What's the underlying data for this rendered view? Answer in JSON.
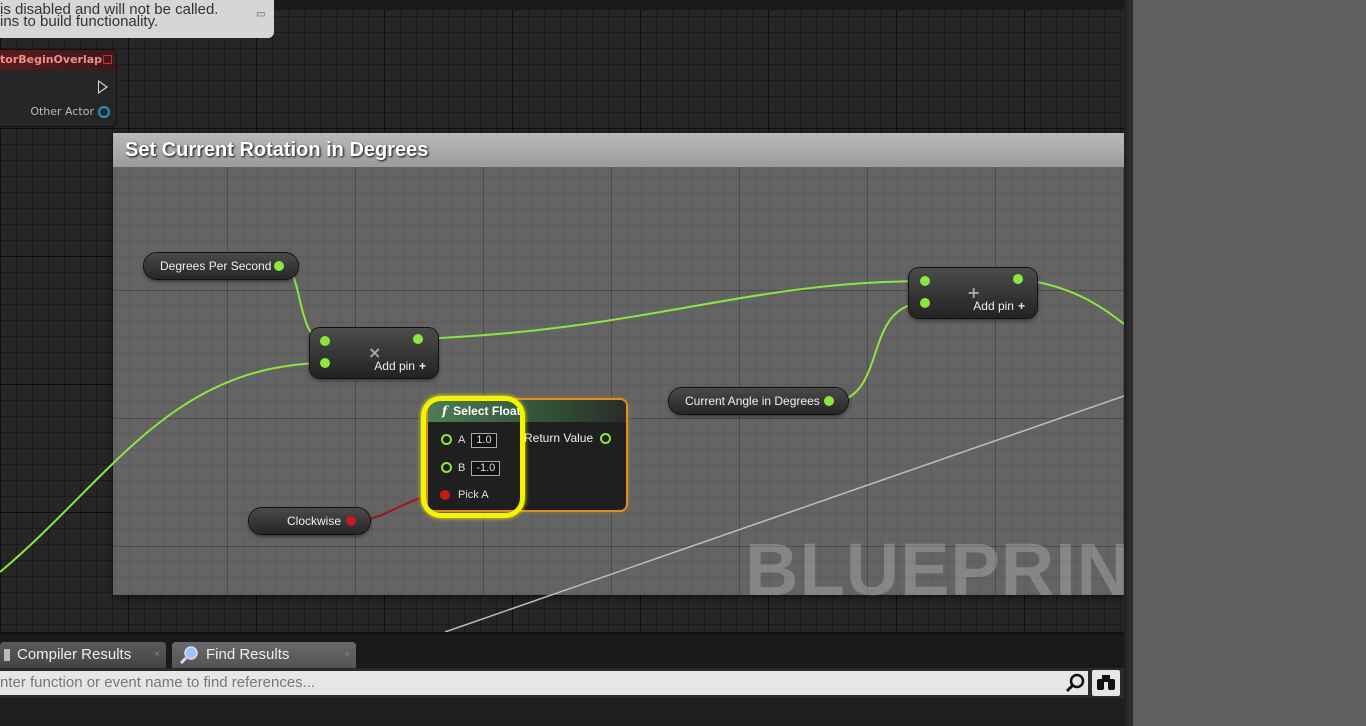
{
  "warning": {
    "line1": "is disabled and will not be called.",
    "line2": "ins to build functionality."
  },
  "event_node": {
    "title": "torBeginOverlap",
    "output_pin": "Other Actor"
  },
  "comment": {
    "title": "Set Current Rotation in Degrees",
    "watermark": "BLUEPRINT"
  },
  "nodes": {
    "degrees_per_second": "Degrees Per Second",
    "current_angle": "Current Angle in Degrees",
    "clockwise": "Clockwise",
    "multiply": {
      "symbol": "×",
      "add_pin": "Add pin",
      "plus": "+"
    },
    "add": {
      "symbol": "+",
      "add_pin": "Add pin",
      "plus": "+"
    },
    "select_float": {
      "icon": "f",
      "title": "Select Float",
      "a_label": "A",
      "a_value": "1.0",
      "b_label": "B",
      "b_value": "-1.0",
      "pick_a": "Pick A",
      "return_value": "Return Value"
    }
  },
  "tabs": [
    {
      "label": "Compiler Results",
      "close": "×"
    },
    {
      "label": "Find Results",
      "close": "×"
    }
  ],
  "search": {
    "placeholder": "nter function or event name to find references..."
  },
  "icons": {
    "search": "magnifier-icon",
    "binoculars": "binoculars-icon"
  },
  "colors": {
    "float_pin": "#8ce640",
    "bool_pin": "#c81a1a",
    "highlight": "#f4f400",
    "select_border": "#e08e1e"
  }
}
